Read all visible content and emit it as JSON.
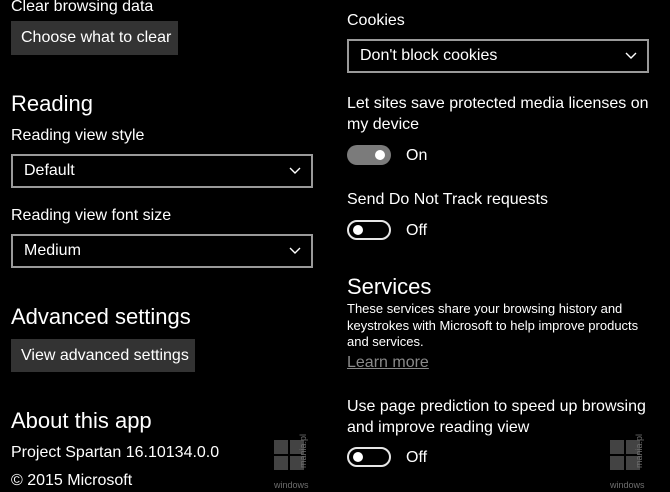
{
  "left": {
    "clear": {
      "label": "Clear browsing data",
      "button": "Choose what to clear"
    },
    "reading": {
      "heading": "Reading",
      "style_label": "Reading view style",
      "style_value": "Default",
      "font_label": "Reading view font size",
      "font_value": "Medium"
    },
    "advanced": {
      "heading": "Advanced settings",
      "button": "View advanced settings"
    },
    "about": {
      "heading": "About this app",
      "version": "Project Spartan 16.10134.0.0",
      "copyright": "© 2015 Microsoft"
    }
  },
  "right": {
    "cookies": {
      "label": "Cookies",
      "value": "Don't block cookies"
    },
    "media": {
      "label_line1": "Let sites save protected media licenses on",
      "label_line2": "my device",
      "state": "On",
      "enabled": true
    },
    "dnt": {
      "label": "Send Do Not Track requests",
      "state": "Off",
      "enabled": false
    },
    "services": {
      "heading": "Services",
      "desc_line1": "These services share your browsing history and",
      "desc_line2": "keystrokes with Microsoft to help improve products",
      "desc_line3": "and services.",
      "learn_more": "Learn more"
    },
    "prediction": {
      "label_line1": "Use page prediction to speed up browsing",
      "label_line2": "and improve reading view",
      "state": "Off",
      "enabled": false
    }
  },
  "watermark": {
    "text_vertical": "mania.pl",
    "text_horizontal": "windows"
  },
  "icons": {
    "dropdown": "chevron-down-icon",
    "watermark_logo": "windows-logo-icon"
  },
  "colors": {
    "background": "#000000",
    "button": "#333333",
    "border": "#9a9a9a",
    "link": "#8a8a8a",
    "toggle_on": "#7b7b7b"
  }
}
